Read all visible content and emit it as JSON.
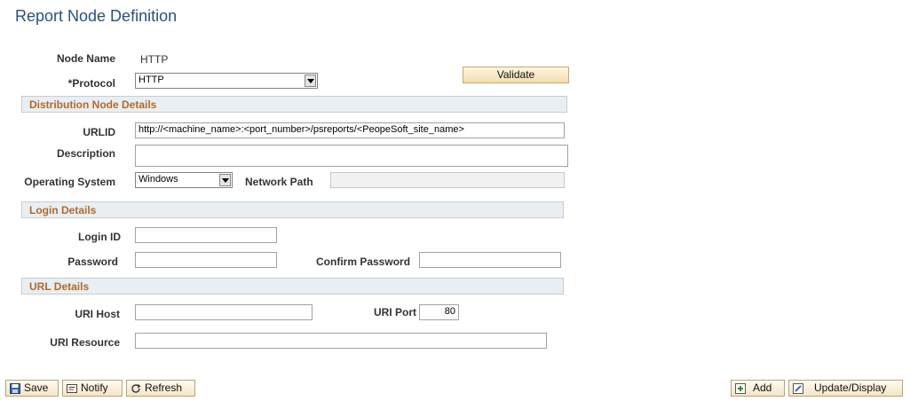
{
  "page": {
    "title": "Report Node Definition"
  },
  "node": {
    "label": "Node Name",
    "value": "HTTP"
  },
  "protocol": {
    "label": "*Protocol",
    "value": "HTTP"
  },
  "validate_button": "Validate",
  "sections": {
    "distribution": "Distribution Node Details",
    "login": "Login Details",
    "url": "URL Details"
  },
  "distribution": {
    "urlid_label": "URLID",
    "urlid_value": "http://<machine_name>:<port_number>/psreports/<PeopeSoft_site_name>",
    "description_label": "Description",
    "description_value": "",
    "os_label": "Operating System",
    "os_value": "Windows",
    "network_path_label": "Network Path",
    "network_path_value": ""
  },
  "login": {
    "login_id_label": "Login ID",
    "login_id_value": "",
    "password_label": "Password",
    "password_value": "",
    "confirm_password_label": "Confirm Password",
    "confirm_password_value": ""
  },
  "url": {
    "host_label": "URI Host",
    "host_value": "",
    "port_label": "URI Port",
    "port_value": "80",
    "resource_label": "URI Resource",
    "resource_value": ""
  },
  "toolbar": {
    "save": "Save",
    "notify": "Notify",
    "refresh": "Refresh",
    "add": "Add",
    "update_display": "Update/Display"
  },
  "icons": {
    "save": "floppy-disk-icon",
    "notify": "notify-icon",
    "refresh": "refresh-icon",
    "add": "add-icon",
    "update_display": "update-display-icon"
  }
}
